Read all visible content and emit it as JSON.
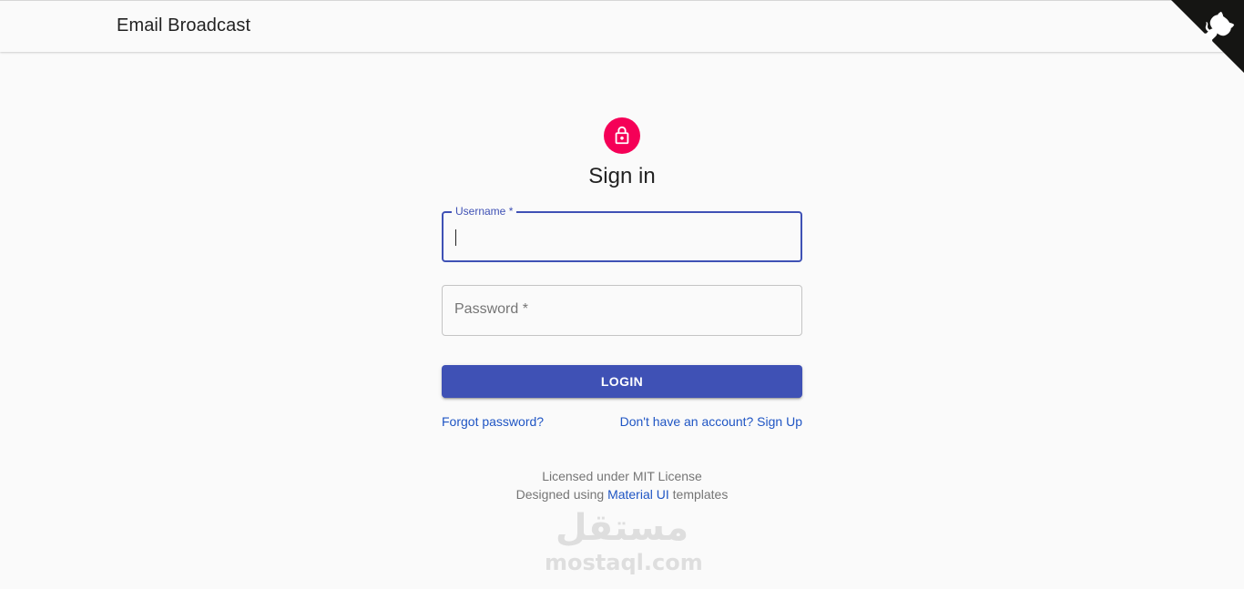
{
  "app": {
    "title": "Email Broadcast"
  },
  "github_corner": {
    "icon": "github-octocat-icon"
  },
  "signin": {
    "avatar_icon": "lock-icon",
    "avatar_color": "#f50057",
    "heading": "Sign in",
    "username": {
      "label": "Username *",
      "value": ""
    },
    "password": {
      "label": "Password *",
      "value": ""
    },
    "login_label": "LOGIN",
    "forgot_link": "Forgot password?",
    "signup_link": "Don't have an account? Sign Up"
  },
  "footer": {
    "license": "Licensed under MIT License",
    "designed_prefix": "Designed using ",
    "designed_link": "Material UI",
    "designed_suffix": " templates"
  },
  "watermark": {
    "arabic": "مستقل",
    "latin": "mostaql.com"
  },
  "colors": {
    "primary": "#3f51b5",
    "secondary": "#f50057",
    "link": "#1f55c4",
    "background": "#fafafa"
  }
}
